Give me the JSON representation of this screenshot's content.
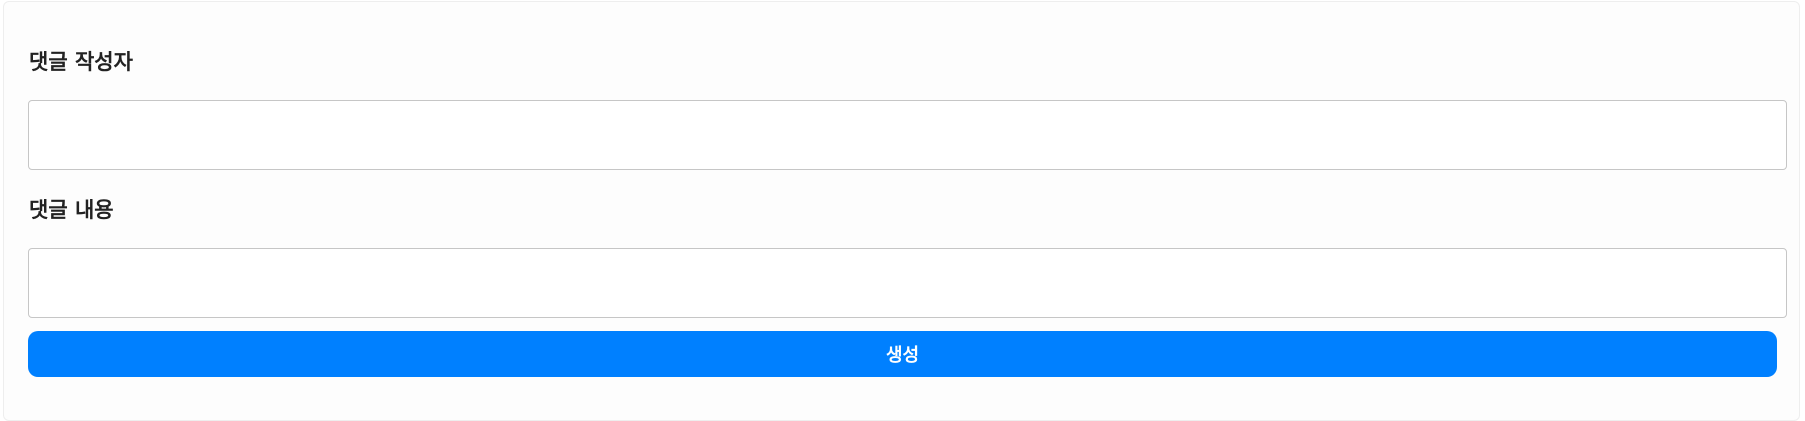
{
  "form": {
    "author_label": "댓글 작성자",
    "author_value": "",
    "content_label": "댓글 내용",
    "content_value": "",
    "submit_label": "생성"
  },
  "colors": {
    "accent": "#0080ff",
    "border": "#c6c6c6"
  }
}
